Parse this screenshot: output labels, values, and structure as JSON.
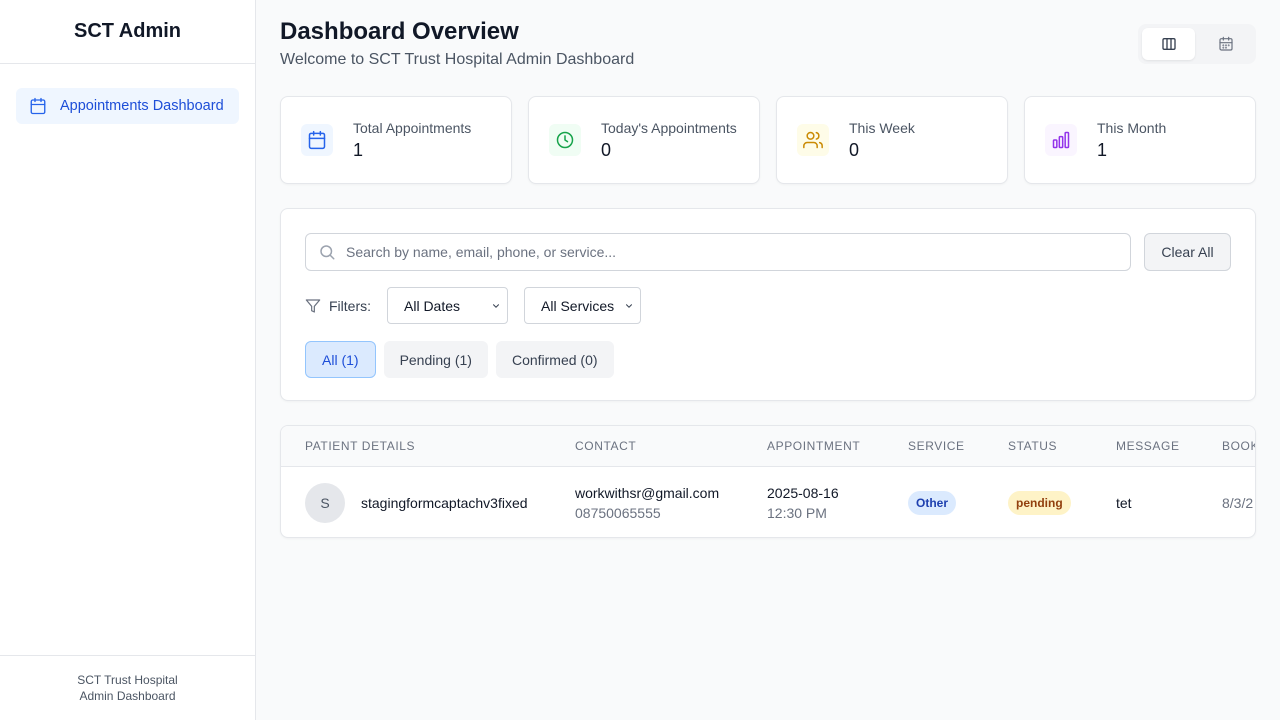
{
  "sidebar": {
    "brand": "SCT Admin",
    "items": [
      {
        "label": "Appointments Dashboard",
        "icon": "calendar-icon",
        "active": true
      }
    ],
    "footer": {
      "line1": "SCT Trust Hospital",
      "line2": "Admin Dashboard"
    }
  },
  "header": {
    "title": "Dashboard Overview",
    "subtitle": "Welcome to SCT Trust Hospital Admin Dashboard"
  },
  "view_toggle": [
    {
      "name": "columns-view-icon",
      "active": true
    },
    {
      "name": "calendar-view-icon",
      "active": false
    }
  ],
  "stats": [
    {
      "label": "Total Appointments",
      "value": "1",
      "icon": "calendar-icon",
      "color": "#2563eb",
      "bg": "#eff6ff"
    },
    {
      "label": "Today's Appointments",
      "value": "0",
      "icon": "clock-icon",
      "color": "#16a34a",
      "bg": "#f0fdf4"
    },
    {
      "label": "This Week",
      "value": "0",
      "icon": "users-icon",
      "color": "#ca8a04",
      "bg": "#fefce8"
    },
    {
      "label": "This Month",
      "value": "1",
      "icon": "bar-chart-icon",
      "color": "#9333ea",
      "bg": "#faf5ff"
    }
  ],
  "search": {
    "placeholder": "Search by name, email, phone, or service...",
    "value": ""
  },
  "clear_label": "Clear All",
  "filters": {
    "label": "Filters:",
    "date": "All Dates",
    "service": "All Services"
  },
  "tabs": [
    {
      "label": "All (1)",
      "active": true
    },
    {
      "label": "Pending (1)",
      "active": false
    },
    {
      "label": "Confirmed (0)",
      "active": false
    }
  ],
  "table": {
    "headers": [
      "PATIENT DETAILS",
      "CONTACT",
      "APPOINTMENT",
      "SERVICE",
      "STATUS",
      "MESSAGE",
      "BOOK"
    ],
    "rows": [
      {
        "initial": "S",
        "name": "stagingformcaptachv3fixed",
        "email": "workwithsr@gmail.com",
        "phone": "08750065555",
        "date": "2025-08-16",
        "time": "12:30 PM",
        "service": "Other",
        "status": "pending",
        "message": "tet",
        "booked": "8/3/2"
      }
    ]
  },
  "colors": {
    "accent": "#1d4ed8",
    "accent_bg": "#eff6ff",
    "border": "#e5e7eb"
  }
}
